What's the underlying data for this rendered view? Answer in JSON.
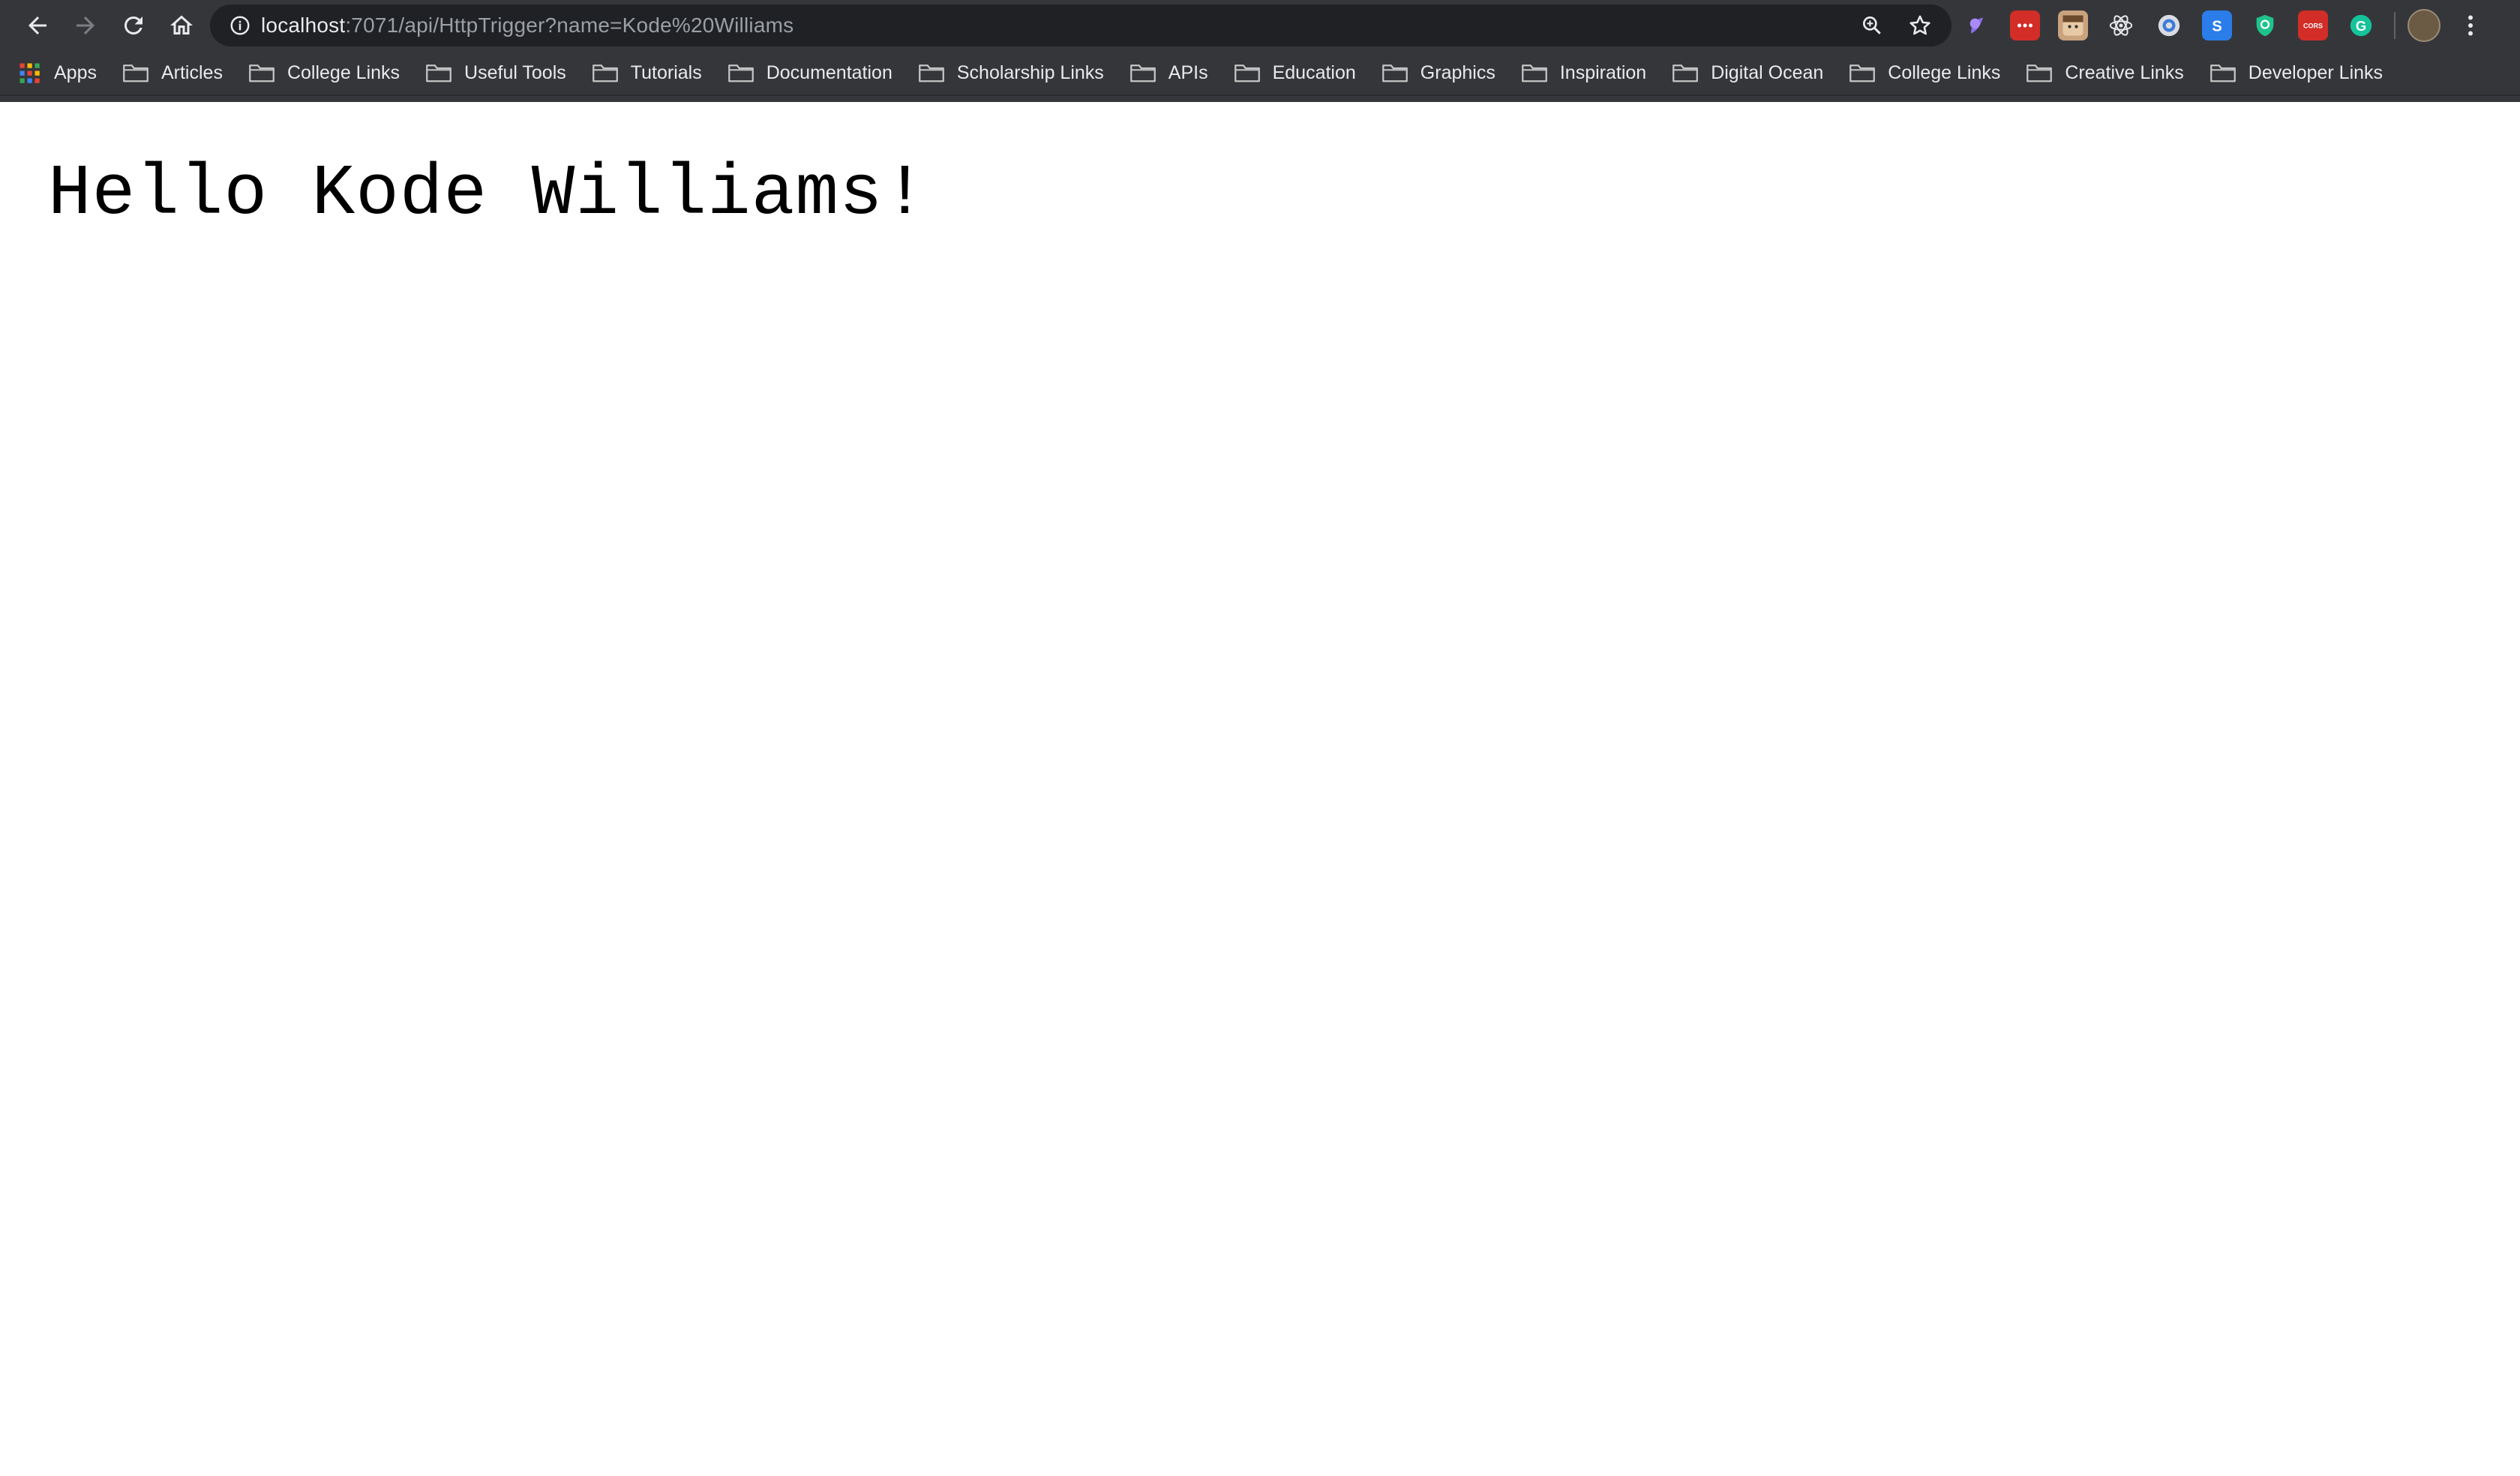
{
  "browser": {
    "url_host": "localhost",
    "url_rest": ":7071/api/HttpTrigger?name=Kode%20Williams",
    "bookmarks": [
      {
        "label": "Apps",
        "icon": "apps-grid-icon"
      },
      {
        "label": "Articles",
        "icon": "folder-icon"
      },
      {
        "label": "College Links",
        "icon": "folder-icon"
      },
      {
        "label": "Useful Tools",
        "icon": "folder-icon"
      },
      {
        "label": "Tutorials",
        "icon": "folder-icon"
      },
      {
        "label": "Documentation",
        "icon": "folder-icon"
      },
      {
        "label": "Scholarship Links",
        "icon": "folder-icon"
      },
      {
        "label": "APIs",
        "icon": "folder-icon"
      },
      {
        "label": "Education",
        "icon": "folder-icon"
      },
      {
        "label": "Graphics",
        "icon": "folder-icon"
      },
      {
        "label": "Inspiration",
        "icon": "folder-icon"
      },
      {
        "label": "Digital Ocean",
        "icon": "folder-icon"
      },
      {
        "label": "College Links",
        "icon": "folder-icon"
      },
      {
        "label": "Creative Links",
        "icon": "folder-icon"
      },
      {
        "label": "Developer Links",
        "icon": "folder-icon"
      }
    ],
    "extensions": [
      {
        "name": "purple-extension-icon",
        "color": "#8e6cf0",
        "text": ""
      },
      {
        "name": "lastpass-extension-icon",
        "color": "#d32d27",
        "text": "•••"
      },
      {
        "name": "face-extension-icon",
        "color": "#c9a27e",
        "text": ""
      },
      {
        "name": "react-devtools-icon",
        "color": "#35363a",
        "text": ""
      },
      {
        "name": "circle-extension-icon",
        "color": "#3d7bd9",
        "text": ""
      },
      {
        "name": "s-extension-icon",
        "color": "#2b7de9",
        "text": "S"
      },
      {
        "name": "shield-extension-icon",
        "color": "#1ec38b",
        "text": ""
      },
      {
        "name": "cors-extension-icon",
        "color": "#d32d27",
        "text": "CORS"
      },
      {
        "name": "grammarly-extension-icon",
        "color": "#15c39a",
        "text": "G"
      }
    ]
  },
  "page": {
    "greeting": "Hello Kode Williams!"
  }
}
